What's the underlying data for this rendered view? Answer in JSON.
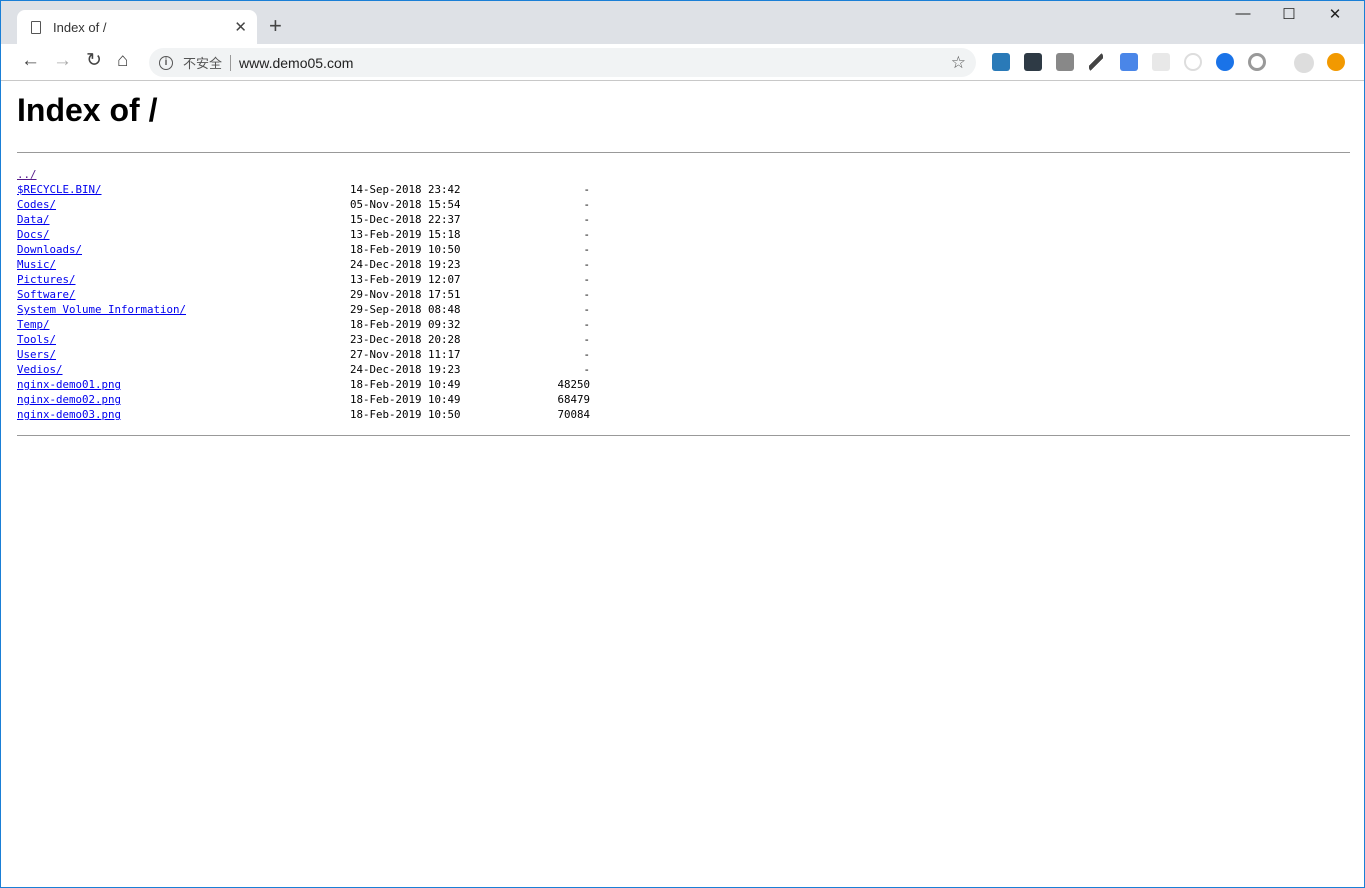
{
  "browser": {
    "tab_title": "Index of /",
    "security_label": "不安全",
    "url": "www.demo05.com",
    "extensions": [
      "s-icon",
      "messenger-icon",
      "gmail-checker-icon",
      "eyedropper-icon",
      "google-translate-icon",
      "react-devtools-icon",
      "camera-icon",
      "blue-extension-icon",
      "gray-ring-icon",
      "cupcake-avatar-icon",
      "warning-icon"
    ]
  },
  "page": {
    "title": "Index of /",
    "entries": [
      {
        "name": "../",
        "date": "",
        "size": ""
      },
      {
        "name": "$RECYCLE.BIN/",
        "date": "14-Sep-2018 23:42",
        "size": "-"
      },
      {
        "name": "Codes/",
        "date": "05-Nov-2018 15:54",
        "size": "-"
      },
      {
        "name": "Data/",
        "date": "15-Dec-2018 22:37",
        "size": "-"
      },
      {
        "name": "Docs/",
        "date": "13-Feb-2019 15:18",
        "size": "-"
      },
      {
        "name": "Downloads/",
        "date": "18-Feb-2019 10:50",
        "size": "-"
      },
      {
        "name": "Music/",
        "date": "24-Dec-2018 19:23",
        "size": "-"
      },
      {
        "name": "Pictures/",
        "date": "13-Feb-2019 12:07",
        "size": "-"
      },
      {
        "name": "Software/",
        "date": "29-Nov-2018 17:51",
        "size": "-"
      },
      {
        "name": "System Volume Information/",
        "date": "29-Sep-2018 08:48",
        "size": "-"
      },
      {
        "name": "Temp/",
        "date": "18-Feb-2019 09:32",
        "size": "-"
      },
      {
        "name": "Tools/",
        "date": "23-Dec-2018 20:28",
        "size": "-"
      },
      {
        "name": "Users/",
        "date": "27-Nov-2018 11:17",
        "size": "-"
      },
      {
        "name": "Vedios/",
        "date": "24-Dec-2018 19:23",
        "size": "-"
      },
      {
        "name": "nginx-demo01.png",
        "date": "18-Feb-2019 10:49",
        "size": "48250"
      },
      {
        "name": "nginx-demo02.png",
        "date": "18-Feb-2019 10:49",
        "size": "68479"
      },
      {
        "name": "nginx-demo03.png",
        "date": "18-Feb-2019 10:50",
        "size": "70084"
      }
    ]
  }
}
